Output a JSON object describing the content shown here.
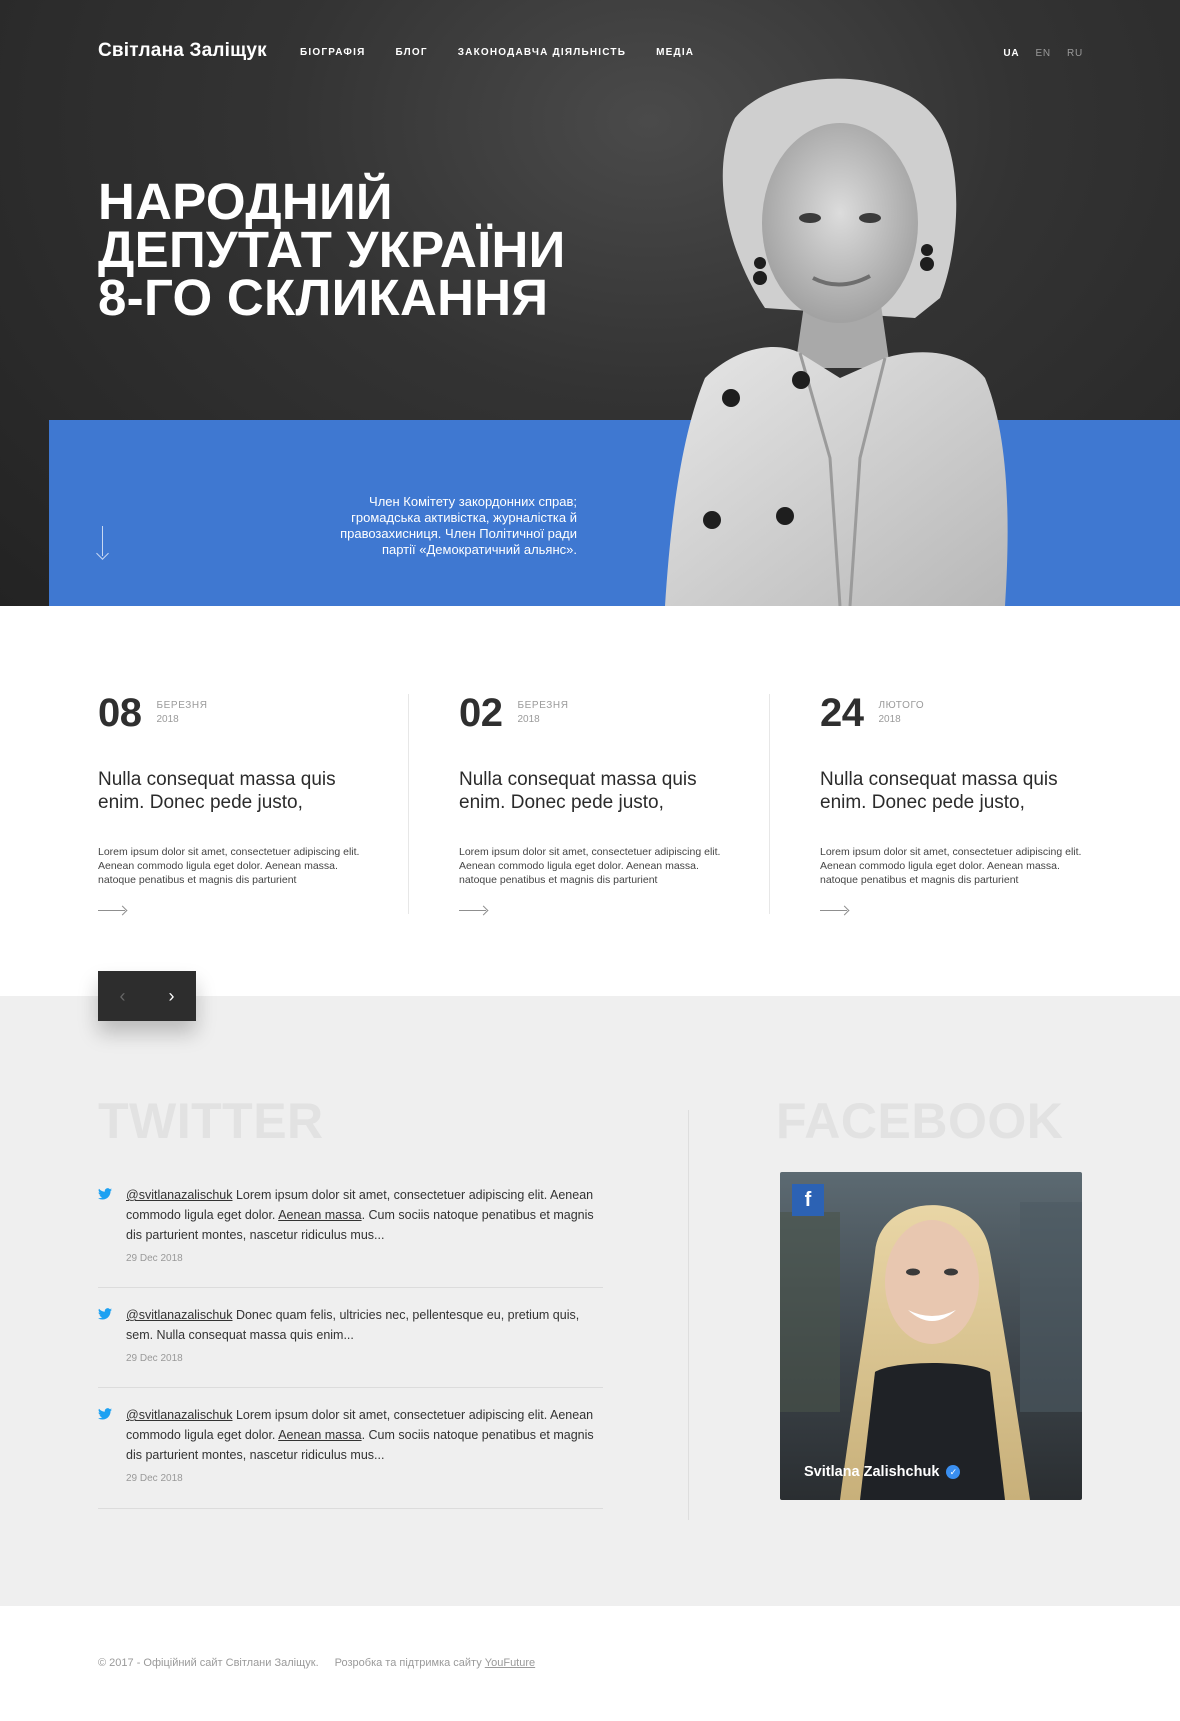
{
  "header": {
    "brand": "Світлана Заліщук",
    "nav": [
      "БІОГРАФІЯ",
      "БЛОГ",
      "ЗАКОНОДАВЧА ДІЯЛЬНІСТЬ",
      "МЕДІА"
    ],
    "langs": [
      "UA",
      "EN",
      "RU"
    ]
  },
  "hero": {
    "title_line1": "НАРОДНИЙ",
    "title_line2": "ДЕПУТАТ УКРАЇНИ",
    "title_line3": "8-ГО СКЛИКАННЯ",
    "description": "Член Комітету закордонних справ; громадська активістка, журналістка й правозахисниця. Член Політичної ради партії «Демократичний альянс»."
  },
  "news": [
    {
      "day": "08",
      "month": "БЕРЕЗНЯ",
      "year": "2018",
      "title": "Nulla consequat massa quis enim. Donec pede justo,",
      "text": "Lorem ipsum dolor sit amet, consectetuer adipiscing elit. Aenean commodo ligula eget dolor. Aenean massa. natoque penatibus et magnis dis parturient"
    },
    {
      "day": "02",
      "month": "БЕРЕЗНЯ",
      "year": "2018",
      "title": "Nulla consequat massa quis enim. Donec pede justo,",
      "text": "Lorem ipsum dolor sit amet, consectetuer adipiscing elit. Aenean commodo ligula eget dolor. Aenean massa. natoque penatibus et magnis dis parturient"
    },
    {
      "day": "24",
      "month": "ЛЮТОГО",
      "year": "2018",
      "title": "Nulla consequat massa quis enim. Donec pede justo,",
      "text": "Lorem ipsum dolor sit amet, consectetuer adipiscing elit. Aenean commodo ligula eget dolor. Aenean massa. natoque penatibus et magnis dis parturient"
    }
  ],
  "slider": {
    "prev": "‹",
    "next": "›"
  },
  "twitter": {
    "title": "TWITTER",
    "tweets": [
      {
        "handle": "@svitlanazalischuk",
        "text_a": " Lorem ipsum dolor sit amet, consectetuer adipiscing elit. Aenean commodo ligula eget dolor. ",
        "link": "Aenean massa",
        "text_b": ". Cum sociis natoque penatibus et magnis dis parturient montes, nascetur ridiculus mus...",
        "date": "29 Dec 2018"
      },
      {
        "handle": "@svitlanazalischuk",
        "text_a": " Donec quam felis, ultricies nec, pellentesque eu, pretium quis, sem. Nulla consequat massa quis enim...",
        "link": "",
        "text_b": "",
        "date": "29 Dec 2018"
      },
      {
        "handle": "@svitlanazalischuk",
        "text_a": " Lorem ipsum dolor sit amet, consectetuer adipiscing elit. Aenean commodo ligula eget dolor. ",
        "link": "Aenean massa",
        "text_b": ". Cum sociis natoque penatibus et magnis dis parturient montes, nascetur ridiculus mus...",
        "date": "29 Dec 2018"
      }
    ]
  },
  "facebook": {
    "title": "FACEBOOK",
    "badge": "f",
    "name": "Svitlana Zalishchuk"
  },
  "footer": {
    "copyright": "© 2017 - Офіційний сайт Світлани Заліщук.",
    "dev_text": "Розробка та підтримка сайту",
    "dev_link": "YouFuture"
  },
  "colors": {
    "accent": "#3f78d1",
    "dark": "#2d2d2d",
    "gray_bg": "#efefef"
  },
  "icons": [
    "arrow-down-icon",
    "arrow-right-icon",
    "twitter-bird-icon",
    "facebook-logo-icon",
    "verified-icon"
  ]
}
